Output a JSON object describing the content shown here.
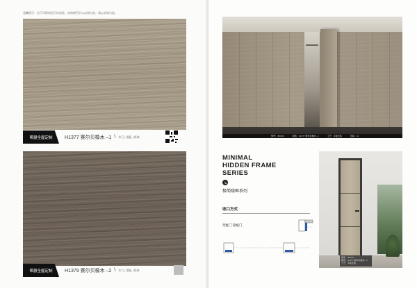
{
  "left_page": {
    "note": "温馨提示：由于印刷和显示的误差，实物颜色仍以实物为准，请以实物为准。",
    "swatches": [
      {
        "brand": "帮爵全屋定制",
        "code": "H1377 赛尔贝橡木 –1",
        "slash": "\\",
        "tags": "木门 | 墙板 | 柜体",
        "color": "#a59a86"
      },
      {
        "brand": "帮爵全屋定制",
        "code": "H1379 赛尔贝橡木 –2",
        "slash": "\\",
        "tags": "木门 | 墙板 | 柜体",
        "color": "#6f645a"
      }
    ]
  },
  "right_page": {
    "photo_caption": {
      "model": "型号：JB-K01",
      "color": "颜色：H1377 赛尔贝橡木 –1",
      "process": "工艺：平板无造",
      "page": "页码：14"
    },
    "title_lines": [
      "MINIMAL",
      "HIDDEN FRAME",
      "SERIES"
    ],
    "subtitle": "极简隐框系列",
    "section_title": "收口方式",
    "door_type": "无框门 隐框门",
    "spec_lines": [
      "型号：JB-K01",
      "颜色：H1377 赛尔贝橡木 –1",
      "工艺：平板无造"
    ]
  }
}
